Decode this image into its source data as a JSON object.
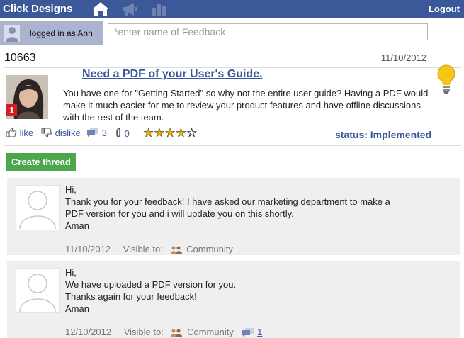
{
  "header": {
    "brand": "Click Designs",
    "logout_label": "Logout",
    "nav_icons": [
      "home-icon",
      "megaphone-icon",
      "bar-chart-icon"
    ],
    "bar_color": "#3b5998"
  },
  "user": {
    "logged_in_text": "logged in as Ann"
  },
  "search": {
    "placeholder": "*enter name of Feedback"
  },
  "feedback": {
    "id": "10663",
    "date": "11/10/2012",
    "title": "Need a PDF of your User's Guide.",
    "body": "You have one for \"Getting Started\" so why not the entire user guide? Having a PDF would make it much easier for me to review your product features and have offline discussions with the rest of the team.",
    "badge": "1",
    "like_label": "like",
    "dislike_label": "dislike",
    "comments_count": "3",
    "attachments_count": "0",
    "rating": 4,
    "rating_max": 5,
    "status_label": "status:",
    "status_value": "Implemented"
  },
  "create_thread_label": "Create thread",
  "threads": [
    {
      "lines": [
        "Hi,",
        "Thank you for your feedback! I have asked our marketing department to make a",
        "PDF version for you and i will update you on this shortly.",
        "Aman"
      ],
      "date": "11/10/2012",
      "visible_label": "Visible to:",
      "visibility": "Community"
    },
    {
      "lines": [
        "Hi,",
        "We have uploaded a PDF version for you.",
        "Thanks again for your feedback!",
        "Aman"
      ],
      "date": "12/10/2012",
      "visible_label": "Visible to:",
      "visibility": "Community",
      "replies": "1"
    }
  ]
}
